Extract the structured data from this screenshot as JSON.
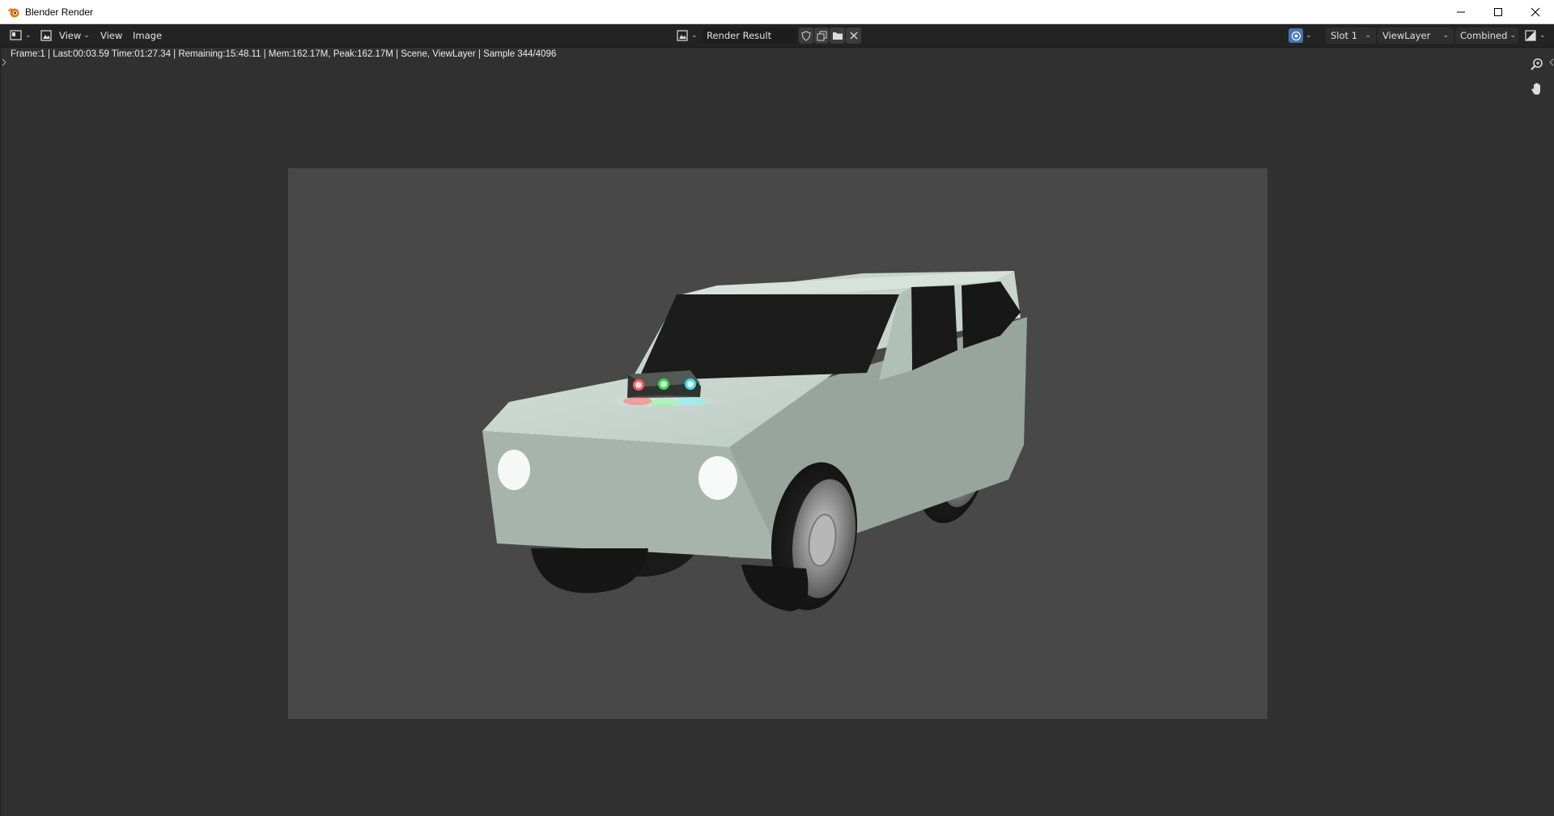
{
  "window": {
    "title": "Blender Render",
    "controls": [
      "minimize",
      "maximize",
      "close"
    ]
  },
  "header": {
    "menus": [
      "View",
      "View",
      "Image"
    ],
    "image_name": "Render Result",
    "slot": "Slot 1",
    "view_layer": "ViewLayer",
    "pass": "Combined"
  },
  "status_text": "Frame:1 | Last:00:03.59 Time:01:27.34 | Remaining:15:48.11 | Mem:162.17M, Peak:162.17M | Scene, ViewLayer | Sample 344/4096",
  "icons": {
    "app": "blender-icon",
    "editor_type": "image-editor-icon",
    "mode": "view-mode-icon",
    "fake_user": "shield-icon",
    "new_image": "duplicate-icon",
    "open_image": "folder-icon",
    "unlink": "close-icon",
    "display_channels": "display-channels-icon",
    "gizmo": "viewer-icon",
    "zoom": "zoom-icon",
    "pan": "hand-icon"
  },
  "colors": {
    "background": "#303030",
    "header": "#232323",
    "render_bg": "#484848",
    "car_body": "#a7b5ad",
    "accent": "#4772b3"
  }
}
